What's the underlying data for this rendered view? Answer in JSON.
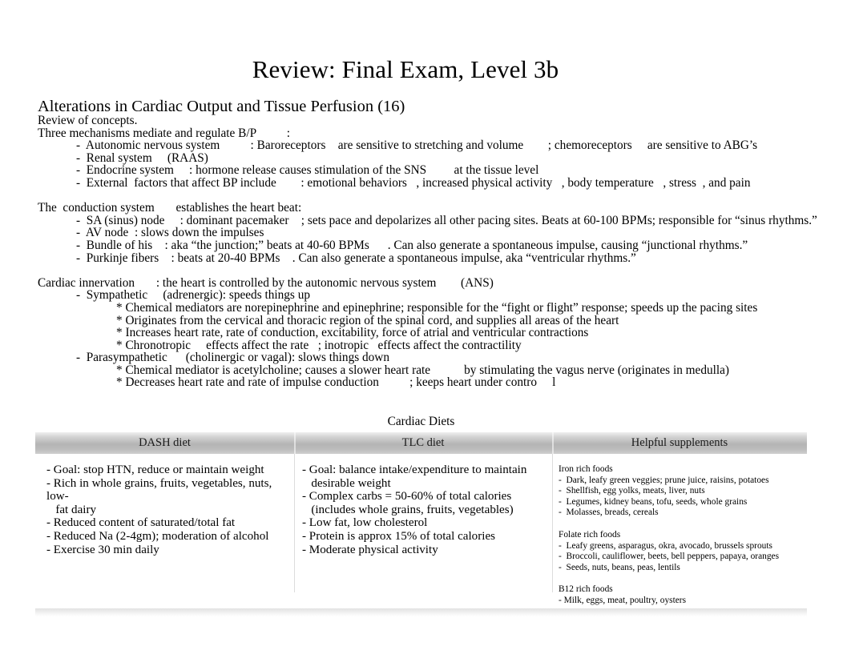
{
  "document": {
    "title": "Review: Final Exam, Level 3b",
    "section_heading": "Alterations in Cardiac Output and Tissue Perfusion (16)"
  },
  "body": {
    "lines": [
      {
        "indent": "none",
        "text": "Review of concepts.",
        "gap_before": false
      },
      {
        "indent": "none",
        "text": "Three mechanisms mediate and regulate B/P          :",
        "gap_before": false
      },
      {
        "indent": "dash",
        "text": "-  Autonomic nervous system          : Baroreceptors    are sensitive to stretching and volume        ; chemoreceptors     are sensitive to ABG’s",
        "gap_before": false
      },
      {
        "indent": "dash",
        "text": "-  Renal system     (RAAS)",
        "gap_before": false
      },
      {
        "indent": "dash",
        "text": "-  Endocrine system     : hormone release causes stimulation of the SNS         at the tissue level",
        "gap_before": false
      },
      {
        "indent": "dash",
        "text": "-  External  factors that affect BP include        : emotional behaviors   , increased physical activity   , body temperature   , stress  , and pain",
        "gap_before": false
      },
      {
        "indent": "none",
        "text": "The  conduction system       establishes the heart beat:",
        "gap_before": true
      },
      {
        "indent": "dash",
        "text": "-  SA (sinus) node     : dominant pacemaker    ; sets pace and depolarizes all other pacing sites. Beats at 60-100 BPMs; responsible for “sinus rhythms.”",
        "gap_before": false
      },
      {
        "indent": "dash",
        "text": "-  AV node  : slows down the impulses",
        "gap_before": false
      },
      {
        "indent": "dash",
        "text": "-  Bundle of his    : aka “the junction;” beats at 40-60 BPMs      . Can also generate a spontaneous impulse, causing “junctional rhythms.”",
        "gap_before": false
      },
      {
        "indent": "dash",
        "text": "-  Purkinje fibers    : beats at 20-40 BPMs    . Can also generate a spontaneous impulse, aka “ventricular rhythms.”",
        "gap_before": false
      },
      {
        "indent": "none",
        "text": "Cardiac innervation       : the heart is controlled by the autonomic nervous system        (ANS)",
        "gap_before": true
      },
      {
        "indent": "dash",
        "text": "-  Sympathetic     (adrenergic): speeds things up",
        "gap_before": false
      },
      {
        "indent": "star",
        "text": "* Chemical mediators are norepinephrine and epinephrine; responsible for the “fight or flight” response; speeds up the pacing sites",
        "gap_before": false
      },
      {
        "indent": "star",
        "text": "* Originates from the cervical and thoracic region of the spinal cord, and supplies all areas of the heart",
        "gap_before": false
      },
      {
        "indent": "star",
        "text": "* Increases heart rate, rate of conduction, excitability, force of atrial and ventricular contractions",
        "gap_before": false
      },
      {
        "indent": "star",
        "text": "* Chronotropic     effects affect the rate   ; inotropic   effects affect the contractility",
        "gap_before": false
      },
      {
        "indent": "dash",
        "text": "-  Parasympathetic      (cholinergic or vagal): slows things down",
        "gap_before": false
      },
      {
        "indent": "star",
        "text": "* Chemical mediator is acetylcholine; causes a slower heart rate           by stimulating the vagus nerve (originates in medulla)",
        "gap_before": false
      },
      {
        "indent": "star",
        "text": "* Decreases heart rate and rate of impulse conduction          ; keeps heart under contro     l",
        "gap_before": false
      }
    ]
  },
  "table": {
    "caption": "Cardiac Diets",
    "headers": [
      "DASH diet",
      "TLC diet",
      "Helpful supplements"
    ],
    "dash_diet_items": [
      "- Goal: stop HTN, reduce or maintain weight",
      "- Rich in whole grains, fruits, vegetables, nuts, low-\n   fat dairy",
      "- Reduced content of saturated/total fat",
      "- Reduced Na (2-4gm); moderation of alcohol",
      "- Exercise 30 min daily"
    ],
    "tlc_diet_items": [
      "- Goal: balance intake/expenditure to maintain\n   desirable weight",
      "- Complex carbs = 50-60% of total calories\n   (includes whole grains, fruits, vegetables)",
      "- Low fat, low cholesterol",
      "- Protein is approx 15% of total calories",
      "- Moderate physical activity"
    ],
    "supplements": [
      {
        "heading": "Iron rich foods",
        "items": [
          "-  Dark, leafy green veggies; prune juice, raisins, potatoes",
          "-  Shellfish, egg yolks, meats, liver, nuts",
          "-  Legumes, kidney beans, tofu, seeds, whole grains",
          "-  Molasses, breads, cereals"
        ]
      },
      {
        "heading": "Folate rich foods",
        "items": [
          "-  Leafy greens, asparagus, okra, avocado, brussels sprouts",
          "-  Broccoli, cauliflower, beets, bell peppers, papaya, oranges",
          "-  Seeds, nuts, beans, peas, lentils"
        ]
      },
      {
        "heading": "B12 rich foods",
        "items": [
          "- Milk, eggs, meat, poultry, oysters"
        ]
      }
    ]
  },
  "colors": {
    "page_background": "#ffffff",
    "text": "#000000",
    "table_header_gray": "#b4b4b4",
    "table_divider": "#dcdcdc"
  }
}
